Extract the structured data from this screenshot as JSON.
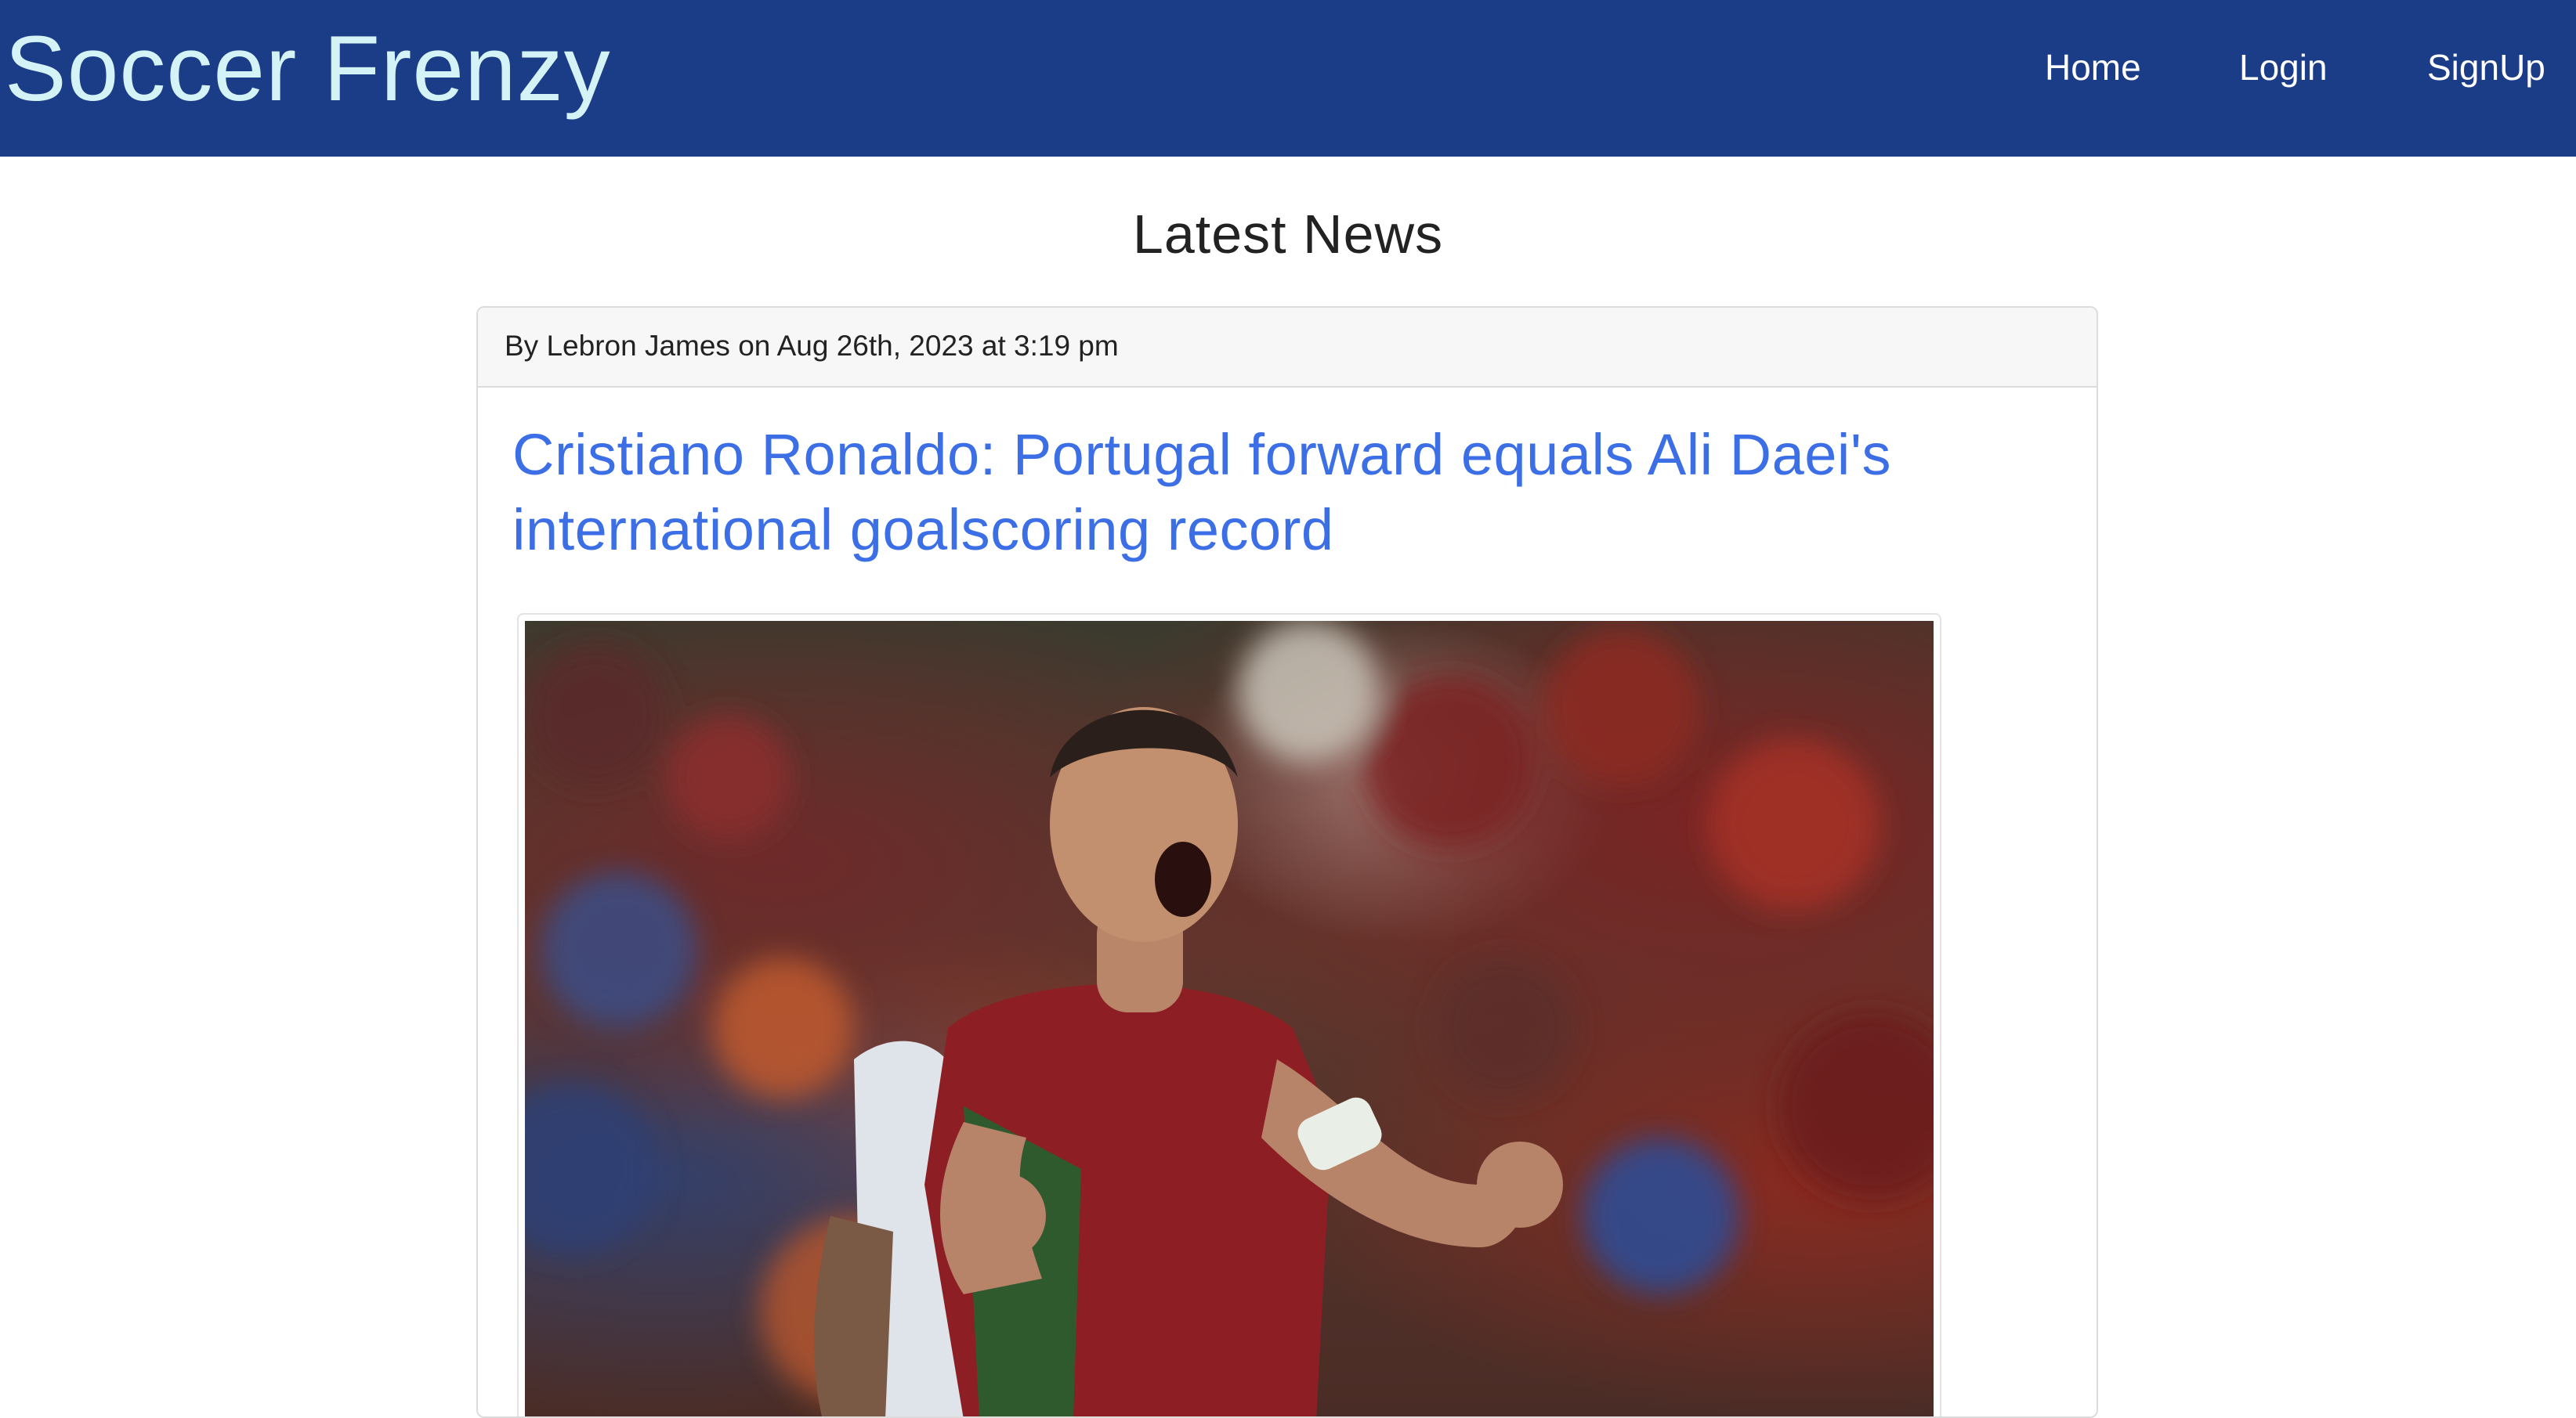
{
  "navbar": {
    "brand": "Soccer Frenzy",
    "links": [
      {
        "label": "Home"
      },
      {
        "label": "Login"
      },
      {
        "label": "SignUp"
      }
    ],
    "background_color": "#1b3c86",
    "brand_color": "#d4f3f7"
  },
  "main": {
    "heading": "Latest News",
    "posts": [
      {
        "byline": "By Lebron James on Aug 26th, 2023 at 3:19 pm",
        "title": "Cristiano Ronaldo: Portugal forward equals Ali Daei's international goalscoring record",
        "title_color": "#3c6ee6",
        "image": "photo of Portugal player in red jersey celebrating with clenched fists"
      }
    ]
  }
}
